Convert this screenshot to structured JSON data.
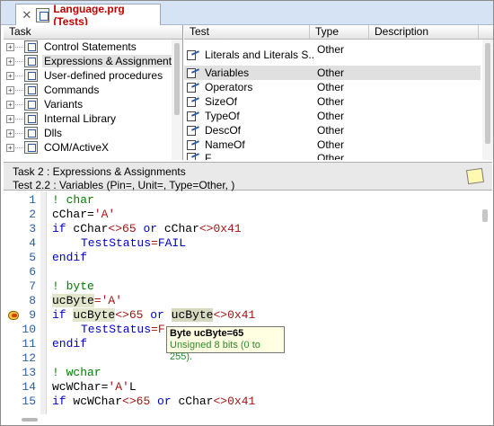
{
  "tab": {
    "title": "Language.prg (Tests)"
  },
  "task_pane": {
    "header": "Task",
    "items": [
      {
        "label": "Control Statements"
      },
      {
        "label": "Expressions & Assignments"
      },
      {
        "label": "User-defined procedures"
      },
      {
        "label": "Commands"
      },
      {
        "label": "Variants"
      },
      {
        "label": "Internal Library"
      },
      {
        "label": "Dlls"
      },
      {
        "label": "COM/ActiveX"
      }
    ]
  },
  "test_pane": {
    "columns": [
      "Test",
      "Type",
      "Description"
    ],
    "rows": [
      {
        "test": "Literals and Literals S...",
        "type": "Other"
      },
      {
        "test": "Variables",
        "type": "Other"
      },
      {
        "test": "Operators",
        "type": "Other"
      },
      {
        "test": "SizeOf",
        "type": "Other"
      },
      {
        "test": "TypeOf",
        "type": "Other"
      },
      {
        "test": "DescOf",
        "type": "Other"
      },
      {
        "test": "NameOf",
        "type": "Other"
      },
      {
        "test": "F...",
        "type": "Other"
      }
    ]
  },
  "info": {
    "task_line": "Task 2 : Expressions & Assignments",
    "test_line": "Test 2.2 : Variables (Pin=, Unit=, Type=Other, )"
  },
  "editor": {
    "lines": [
      {
        "n": "1"
      },
      {
        "n": "2"
      },
      {
        "n": "3"
      },
      {
        "n": "4"
      },
      {
        "n": "5"
      },
      {
        "n": "6"
      },
      {
        "n": "7"
      },
      {
        "n": "8"
      },
      {
        "n": "9"
      },
      {
        "n": "10"
      },
      {
        "n": "11"
      },
      {
        "n": "12"
      },
      {
        "n": "13"
      },
      {
        "n": "14"
      },
      {
        "n": "15"
      }
    ],
    "tok": {
      "t1": "! char",
      "t2a": "cChar=",
      "t2b": "'A'",
      "t3a": "if",
      "t3b": " cChar",
      "t3c": "<>",
      "t3d": "65",
      "t3e": " or ",
      "t3f": "cChar",
      "t3g": "<>",
      "t3h": "0x41",
      "t4a": "TestStatus",
      "t4b": "=",
      "t4c": "FAIL",
      "t5": "endif",
      "t7": "! byte",
      "t8a": "ucByte",
      "t8b": "=",
      "t8c": "'A'",
      "t9a": "if",
      "t9b": "ucByte",
      "t9c": "<>",
      "t9d": "65",
      "t9e": " or ",
      "t9f": "ucByte",
      "t9g": "<>",
      "t9h": "0x41",
      "t10a": "TestStatus",
      "t10b": "=F",
      "t11": "endif",
      "t13": "! wchar",
      "t14a": "wcWChar=",
      "t14b": "'A'",
      "t14c": "L",
      "t15a": "if",
      "t15b": " wcWChar",
      "t15c": "<>",
      "t15d": "65",
      "t15e": " or ",
      "t15f": "cChar",
      "t15g": "<>",
      "t15h": "0x41"
    }
  },
  "tooltip": {
    "title": "Byte ucByte=65",
    "detail": "Unsigned 8 bits (0 to 255)."
  }
}
